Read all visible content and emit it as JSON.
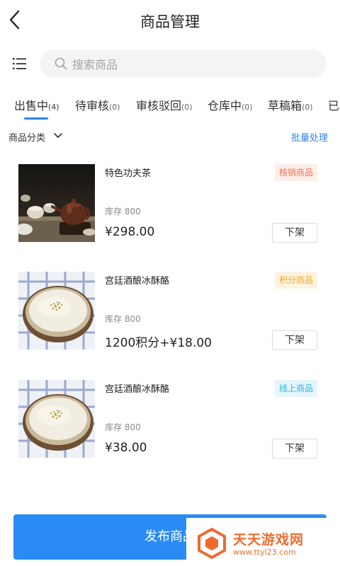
{
  "header": {
    "title": "商品管理",
    "back_icon": "chevron-left-icon"
  },
  "search": {
    "placeholder": "搜索商品",
    "value": "",
    "menu_icon": "list-menu-icon",
    "icon": "search-icon"
  },
  "tabs": [
    {
      "label": "出售中",
      "count": "(4)",
      "active": true
    },
    {
      "label": "待审核",
      "count": "(0)"
    },
    {
      "label": "审核驳回",
      "count": "(0)"
    },
    {
      "label": "仓库中",
      "count": "(0)"
    },
    {
      "label": "草稿箱",
      "count": "(0)"
    },
    {
      "label": "已",
      "count": ""
    }
  ],
  "filter": {
    "category_label": "商品分类",
    "batch_label": "批量处理"
  },
  "products": [
    {
      "name": "特色功夫茶",
      "badge": "核销商品",
      "badge_color": "#f56c4e",
      "badge_bg": "#fdeee9",
      "stock": "库存 800",
      "price": "¥298.00",
      "action": "下架",
      "image": "tea-set-photo"
    },
    {
      "name": "宫廷酒酿冰酥酪",
      "badge": "积分商品",
      "badge_color": "#f5a623",
      "badge_bg": "#fdf3e1",
      "stock": "库存 800",
      "price": "1200积分+¥18.00",
      "action": "下架",
      "image": "dessert-bowl-photo"
    },
    {
      "name": "宫廷酒酿冰酥酪",
      "badge": "线上商品",
      "badge_color": "#2bb3e8",
      "badge_bg": "#e5f5fc",
      "stock": "库存 800",
      "price": "¥38.00",
      "action": "下架",
      "image": "dessert-bowl-photo"
    }
  ],
  "publish_label": "发布商品",
  "watermark": {
    "name": "天天游戏网",
    "url": "www.ttyl23.com"
  },
  "colors": {
    "accent": "#2d84f5",
    "primary_button": "#2b8bf4",
    "watermark": "#ee6b2f"
  }
}
